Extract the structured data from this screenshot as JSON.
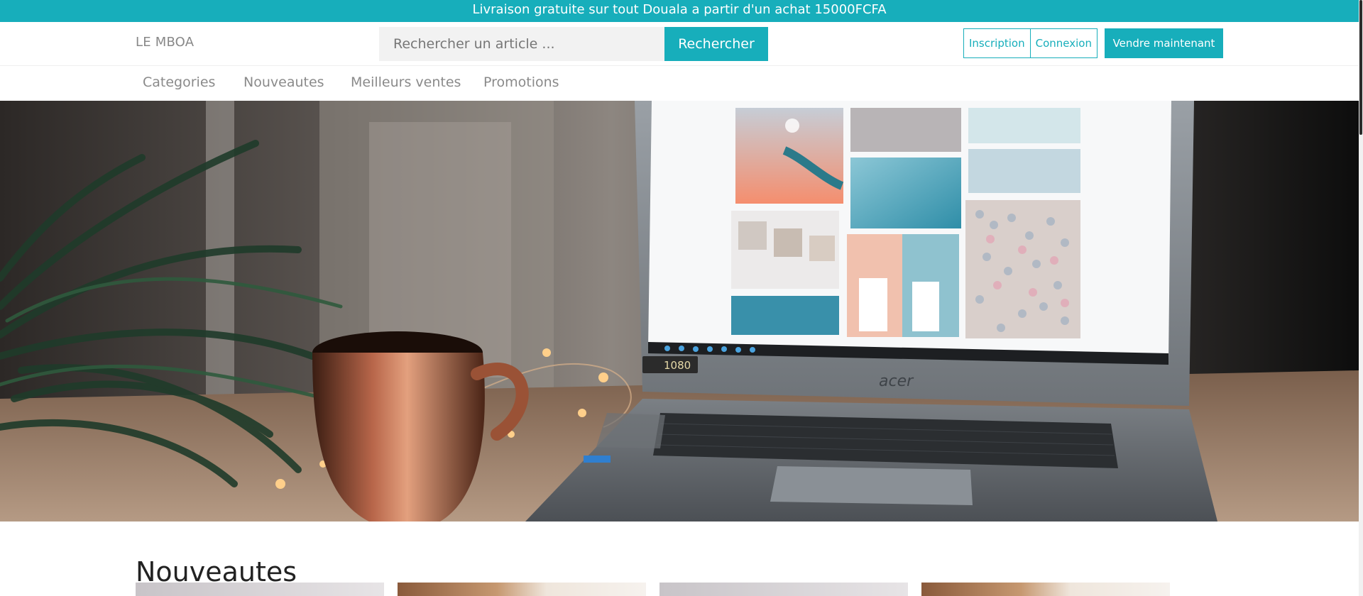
{
  "promo": {
    "text": "Livraison gratuite sur tout Douala a partir d'un achat 15000FCFA"
  },
  "header": {
    "logo": "LE MBOA",
    "search_placeholder": "Rechercher un article ...",
    "search_button": "Rechercher",
    "signup": "Inscription",
    "login": "Connexion",
    "sell": "Vendre maintenant"
  },
  "nav": {
    "items": [
      "Categories",
      "Nouveautes",
      "Meilleurs ventes",
      "Promotions"
    ]
  },
  "hero": {
    "laptop_brand": "acer",
    "display_badge": "1080"
  },
  "section": {
    "title": "Nouveautes"
  },
  "colors": {
    "accent": "#17aebb",
    "text_muted": "#8a8a8a"
  }
}
